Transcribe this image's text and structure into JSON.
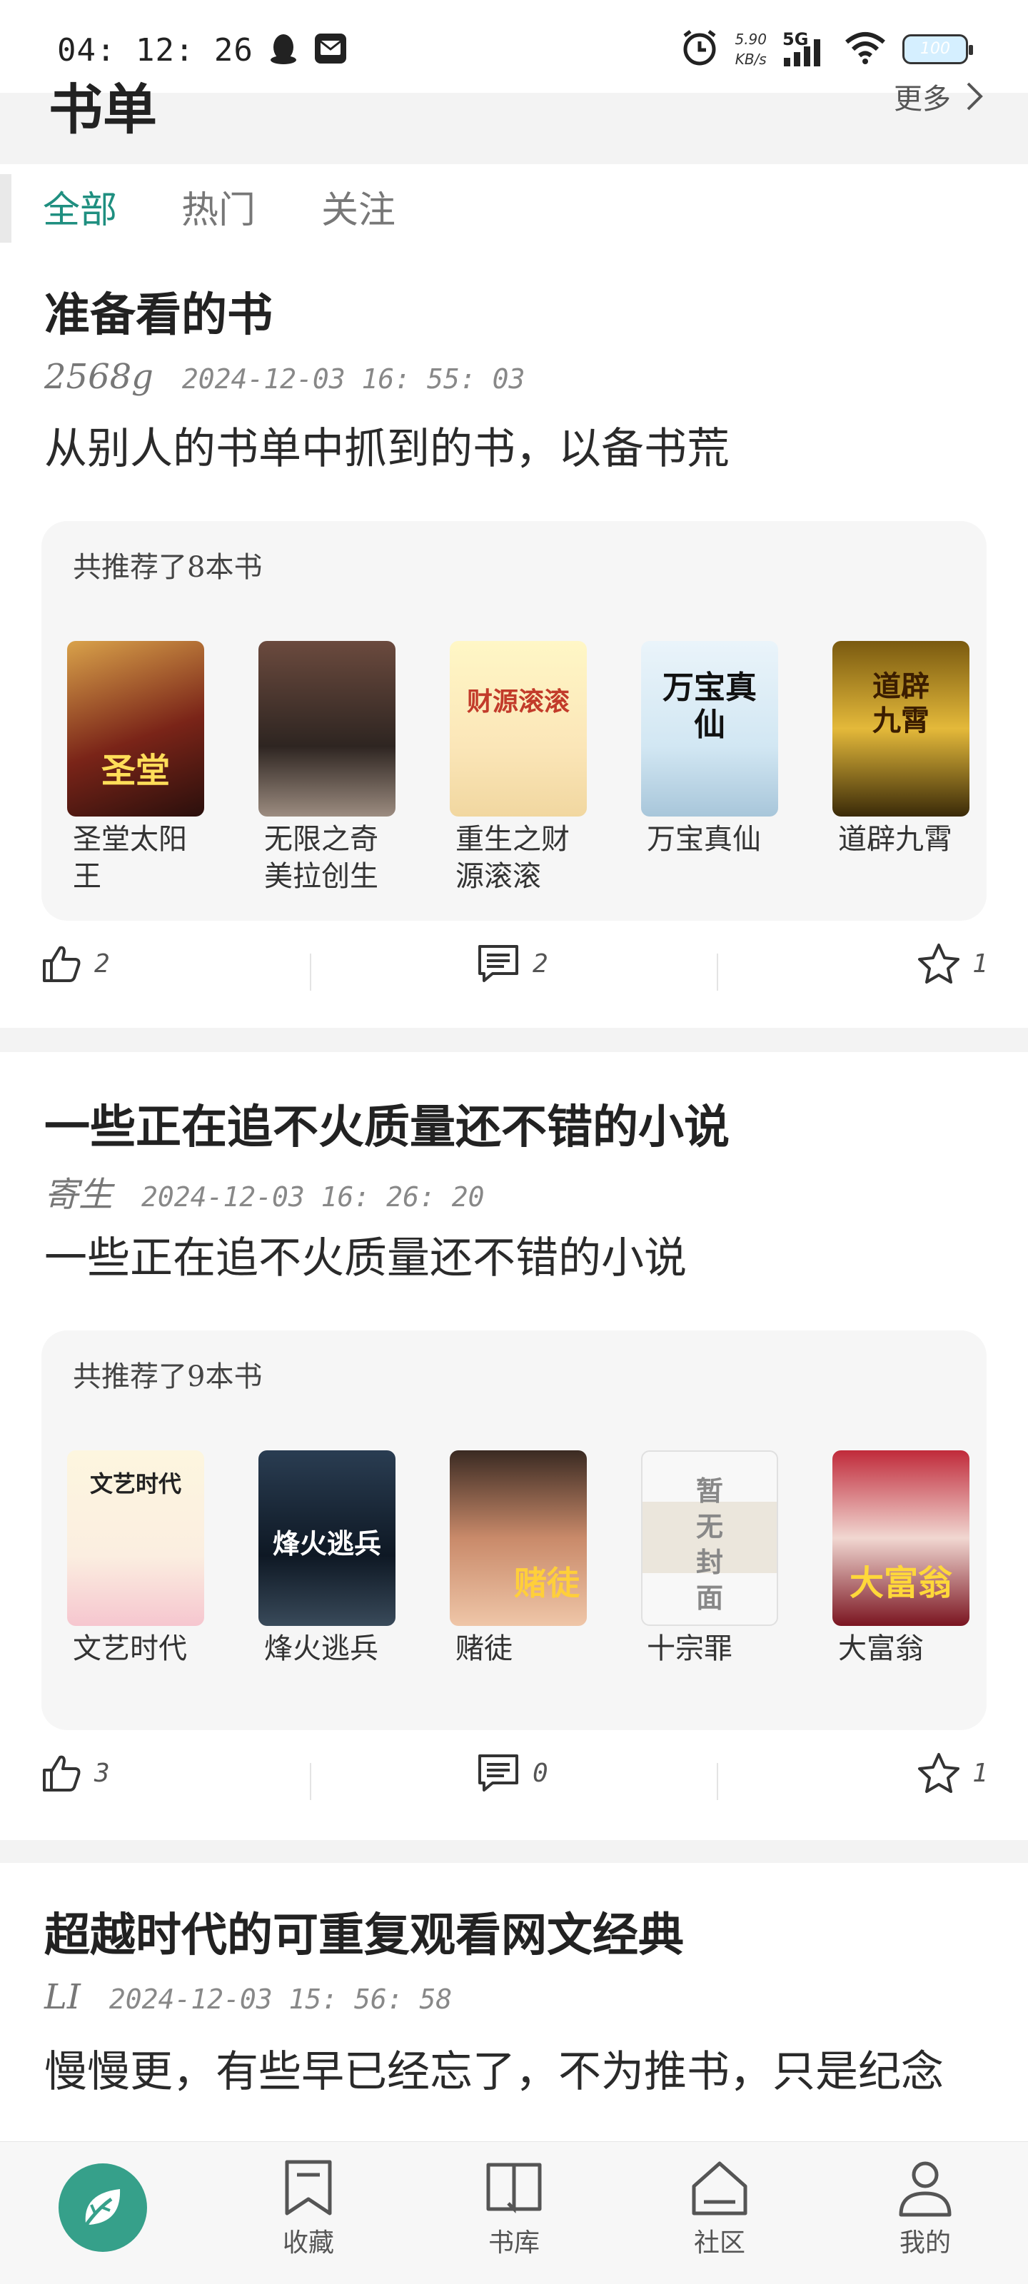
{
  "status_bar": {
    "time": "04: 12: 26",
    "net_speed_value": "5.90",
    "net_speed_unit": "KB/s",
    "network": "5G",
    "battery": "100"
  },
  "header": {
    "title": "书单",
    "more_label": "更多"
  },
  "tabs": [
    {
      "label": "全部",
      "active": true
    },
    {
      "label": "热门"
    },
    {
      "label": "关注"
    }
  ],
  "booklists": [
    {
      "title": "准备看的书",
      "author": "2568g",
      "date": "2024-12-03 16: 55: 03",
      "description": "从别人的书单中抓到的书，以备书荒",
      "book_count_label": "共推荐了8本书",
      "books": [
        {
          "name": "圣堂太阳王",
          "cover_text": "圣堂"
        },
        {
          "name": "无限之奇美拉创生",
          "cover_text": ""
        },
        {
          "name": "重生之财源滚滚",
          "cover_text": "财源滚滚"
        },
        {
          "name": "万宝真仙",
          "cover_text": "万宝真仙"
        },
        {
          "name": "道辟九霄",
          "cover_text": "道辟九霄"
        }
      ],
      "likes": "2",
      "comments": "2",
      "favorites": "1"
    },
    {
      "title": "一些正在追不火质量还不错的小说",
      "author": "寄生",
      "date": "2024-12-03 16: 26: 20",
      "description": "一些正在追不火质量还不错的小说",
      "book_count_label": "共推荐了9本书",
      "books": [
        {
          "name": "文艺时代",
          "cover_text": "文艺时代"
        },
        {
          "name": "烽火逃兵",
          "cover_text": "烽火逃兵"
        },
        {
          "name": "赌徒",
          "cover_text": "赌徒"
        },
        {
          "name": "十宗罪",
          "cover_text": "暂无封面"
        },
        {
          "name": "大富翁",
          "cover_text": "大富翁"
        }
      ],
      "likes": "3",
      "comments": "0",
      "favorites": "1"
    },
    {
      "title": "超越时代的可重复观看网文经典",
      "author": "LI",
      "date": "2024-12-03 15: 56: 58",
      "description": "慢慢更，有些早已经忘了，不为推书，只是纪念"
    }
  ],
  "bottom_nav": [
    {
      "label": "",
      "icon": "leaf-icon",
      "active": true
    },
    {
      "label": "收藏",
      "icon": "bookmark-icon"
    },
    {
      "label": "书库",
      "icon": "book-icon"
    },
    {
      "label": "社区",
      "icon": "home-icon"
    },
    {
      "label": "我的",
      "icon": "person-icon"
    }
  ],
  "colors": {
    "accent": "#1f8f80",
    "tab_underline": "#f5d64a",
    "home_button": "#36a08a"
  }
}
